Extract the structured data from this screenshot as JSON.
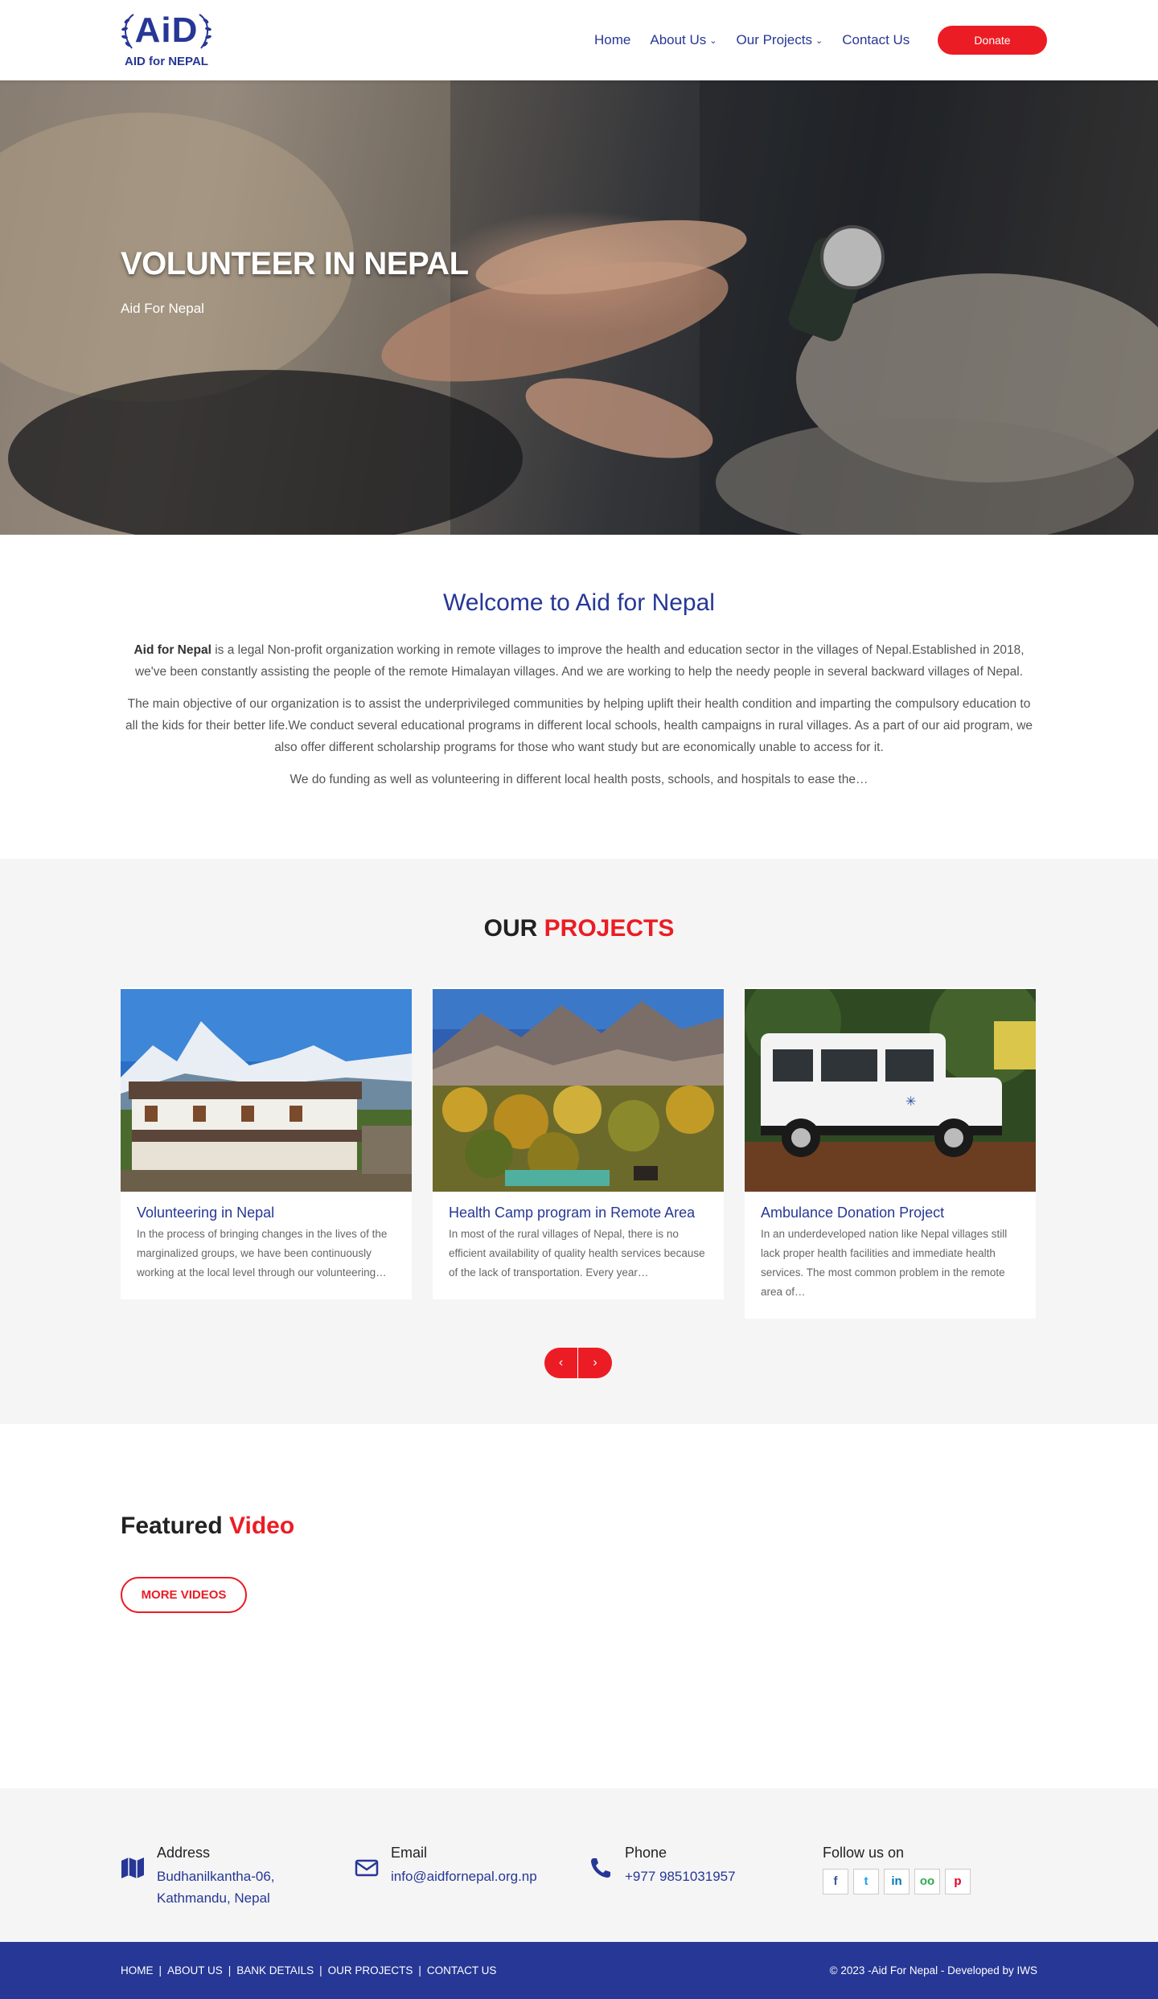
{
  "header": {
    "logo_main": "AiD",
    "logo_sub": "AID for NEPAL",
    "nav": [
      {
        "label": "Home",
        "dropdown": false
      },
      {
        "label": "About Us",
        "dropdown": true
      },
      {
        "label": "Our Projects",
        "dropdown": true
      },
      {
        "label": "Contact Us",
        "dropdown": false
      }
    ],
    "donate_label": "Donate"
  },
  "hero": {
    "title": "VOLUNTEER IN NEPAL",
    "subtitle": "Aid For Nepal"
  },
  "welcome": {
    "title": "Welcome to Aid for Nepal",
    "p1_bold": "Aid for Nepal",
    "p1_rest": " is a legal Non-profit organization working in remote villages to improve the health and education sector in the villages of Nepal.Established in 2018, we've been constantly assisting the people of the remote Himalayan villages. And we are working to help the needy people in several backward villages of Nepal.",
    "p2": "The main objective of our organization is to assist the underprivileged communities by helping uplift their health condition and imparting the compulsory education to all the kids for their better life.We conduct several educational programs in different local schools, health campaigns in rural villages. As a part of our aid program, we also offer different scholarship programs for those who want study but are economically unable to access for it.",
    "p3": "We do funding as well as volunteering in different local health posts, schools, and hospitals to ease the…"
  },
  "projects": {
    "title_a": "OUR ",
    "title_b": "PROJECTS",
    "cards": [
      {
        "title": "Volunteering in Nepal",
        "desc": "In the process of bringing changes in the lives of the marginalized groups, we have been continuously working at the local level through our volunteering…"
      },
      {
        "title": "Health Camp program in Remote Area",
        "desc": "In most of the rural villages of Nepal, there is no efficient availability of quality health services because of the lack of transportation.  Every year…"
      },
      {
        "title": "Ambulance Donation Project",
        "desc": "In an underdeveloped nation like Nepal villages still lack proper health facilities and immediate health services. The most common problem in the remote area of…"
      }
    ],
    "prev": "‹",
    "next": "›"
  },
  "featured": {
    "title_a": "Featured ",
    "title_b": "Video",
    "more_label": "MORE VIDEOS"
  },
  "contact": {
    "address_label": "Address",
    "address_value_1": "Budhanilkantha-06,",
    "address_value_2": "Kathmandu, Nepal",
    "email_label": "Email",
    "email_value": "info@aidfornepal.org.np",
    "phone_label": "Phone",
    "phone_value": "+977 9851031957",
    "follow_label": "Follow us on",
    "socials": [
      "f",
      "t",
      "in",
      "oo",
      "p"
    ]
  },
  "footer": {
    "links": [
      "HOME",
      "ABOUT US",
      "BANK DETAILS",
      "OUR PROJECTS",
      "CONTACT US"
    ],
    "copyright": "© 2023 -Aid For Nepal - Developed by IWS"
  },
  "colors": {
    "brand_blue": "#263796",
    "accent_red": "#ec1c24",
    "section_gray": "#f5f5f5"
  }
}
